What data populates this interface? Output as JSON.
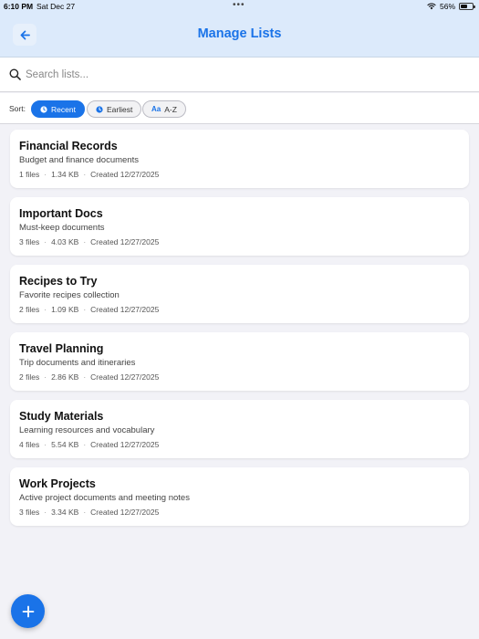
{
  "status_bar": {
    "time": "6:10 PM",
    "date": "Sat Dec 27",
    "battery": "56%",
    "battery_level": 0.56
  },
  "header": {
    "title": "Manage Lists",
    "back_icon": "arrow-left-icon"
  },
  "search": {
    "placeholder": "Search lists...",
    "value": ""
  },
  "sort": {
    "label": "Sort:",
    "options": [
      {
        "label": "Recent",
        "icon": "clock-icon",
        "active": true
      },
      {
        "label": "Earliest",
        "icon": "clock-icon",
        "active": false
      },
      {
        "label": "A-Z",
        "icon_text": "Aa",
        "active": false
      }
    ]
  },
  "lists": [
    {
      "title": "Financial Records",
      "description": "Budget and finance documents",
      "files": "1 files",
      "size": "1.34 KB",
      "created": "Created 12/27/2025"
    },
    {
      "title": "Important Docs",
      "description": "Must-keep documents",
      "files": "3 files",
      "size": "4.03 KB",
      "created": "Created 12/27/2025"
    },
    {
      "title": "Recipes to Try",
      "description": "Favorite recipes collection",
      "files": "2 files",
      "size": "1.09 KB",
      "created": "Created 12/27/2025"
    },
    {
      "title": "Travel Planning",
      "description": "Trip documents and itineraries",
      "files": "2 files",
      "size": "2.86 KB",
      "created": "Created 12/27/2025"
    },
    {
      "title": "Study Materials",
      "description": "Learning resources and vocabulary",
      "files": "4 files",
      "size": "5.54 KB",
      "created": "Created 12/27/2025"
    },
    {
      "title": "Work Projects",
      "description": "Active project documents and meeting notes",
      "files": "3 files",
      "size": "3.34 KB",
      "created": "Created 12/27/2025"
    }
  ],
  "fab": {
    "icon": "plus-icon"
  },
  "colors": {
    "accent": "#1a73e8",
    "header_bg": "#dceafb",
    "page_bg": "#f2f2f7"
  }
}
